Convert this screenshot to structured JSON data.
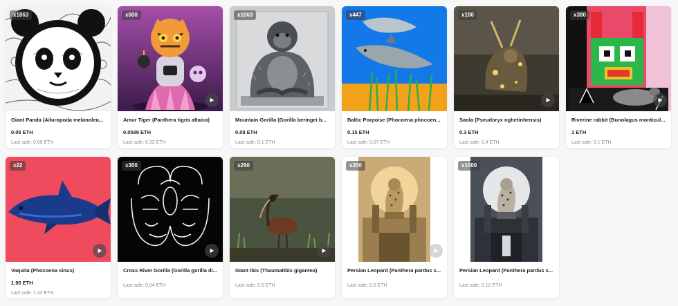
{
  "cards": [
    {
      "badge": "x1863",
      "title": "Giant Panda (Ailuropoda melanoleu...",
      "price": "0.05 ETH",
      "last_sale": "Last sale: 0.09 ETH",
      "has_video": false
    },
    {
      "badge": "x600",
      "title": "Amur Tiger (Panthera tigris altaica)",
      "price": "0.0599 ETH",
      "last_sale": "Last sale: 0.33 ETH",
      "has_video": true
    },
    {
      "badge": "x1063",
      "title": "Mountain Gorilla (Gorilla beringei b...",
      "price": "0.08 ETH",
      "last_sale": "Last sale: 0.1 ETH",
      "has_video": false
    },
    {
      "badge": "x447",
      "title": "Baltic Porpoise (Phocoena phocoen...",
      "price": "0.15 ETH",
      "last_sale": "Last sale: 0.07 ETH",
      "has_video": false
    },
    {
      "badge": "x100",
      "title": "Saola (Pseudoryx nghetinhensis)",
      "price": "0.3 ETH",
      "last_sale": "Last sale: 0.4 ETH",
      "has_video": true
    },
    {
      "badge": "x380",
      "title": "Riverine rabbit (Bunolagus monticul...",
      "price": "1 ETH",
      "last_sale": "Last sale: 0.1 ETH",
      "has_video": true
    },
    {
      "badge": "x22",
      "title": "Vaquita (Phocoena sinus)",
      "price": "1.95 ETH",
      "last_sale": "Last sale: 1.43 ETH",
      "has_video": true
    },
    {
      "badge": "x300",
      "title": "Cross River Gorilla (Gorilla gorilla di...",
      "price": "",
      "last_sale": "Last sale: 0.04 ETH",
      "has_video": true
    },
    {
      "badge": "x290",
      "title": "Giant Ibis (Thaumatibis gigantea)",
      "price": "",
      "last_sale": "Last sale: 0.5 ETH",
      "has_video": true
    },
    {
      "badge": "x200",
      "title": "Persian Leopard (Panthera pardus s...",
      "price": "",
      "last_sale": "Last sale: 0.6 ETH",
      "has_video": true
    },
    {
      "badge": "x1000",
      "title": "Persian Leopard (Panthera pardus s...",
      "price": "",
      "last_sale": "Last sale: 0.12 ETH",
      "has_video": false
    }
  ]
}
